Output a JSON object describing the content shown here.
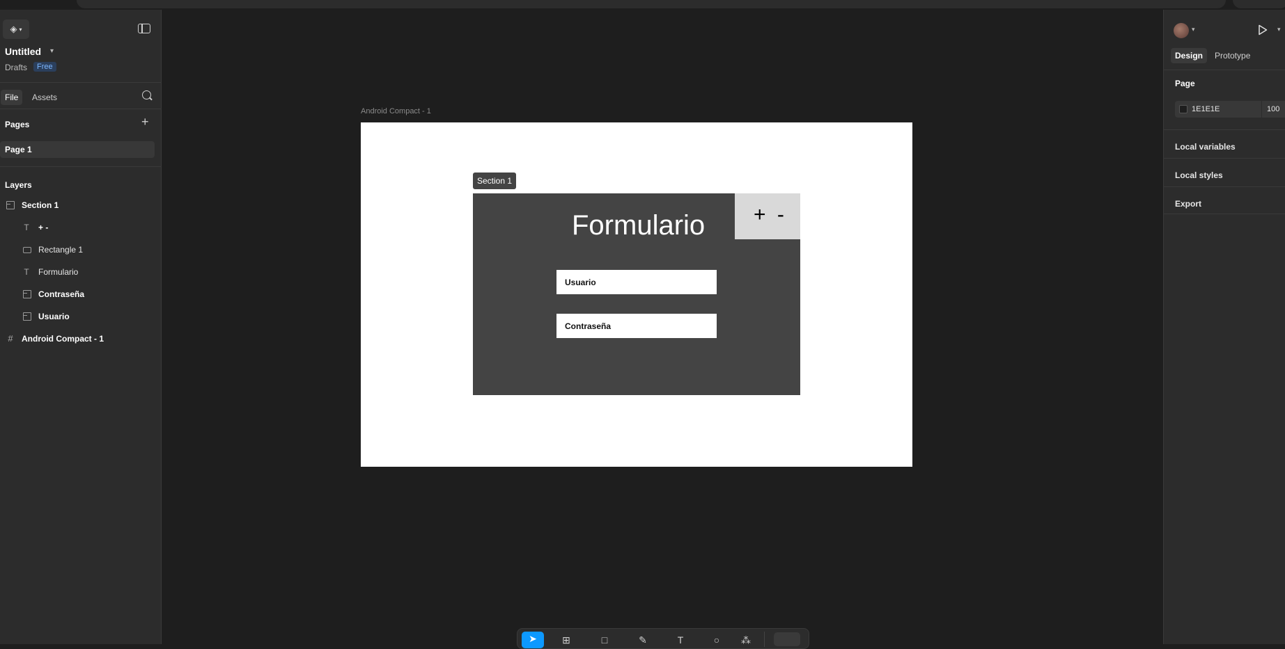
{
  "left": {
    "file_title": "Untitled",
    "drafts_label": "Drafts",
    "plan_badge": "Free",
    "tabs": {
      "file": "File",
      "assets": "Assets"
    },
    "pages_heading": "Pages",
    "pages": [
      "Page 1"
    ],
    "layers_heading": "Layers",
    "layers": [
      {
        "label": "Section 1",
        "icon": "section-icon"
      },
      {
        "label": "+ -",
        "icon": "text-icon"
      },
      {
        "label": "Rectangle 1",
        "icon": "rectangle-icon"
      },
      {
        "label": "Formulario",
        "icon": "text-icon"
      },
      {
        "label": "Contraseña",
        "icon": "section-icon"
      },
      {
        "label": "Usuario",
        "icon": "section-icon"
      },
      {
        "label": "Android Compact - 1",
        "icon": "frame-icon"
      }
    ]
  },
  "canvas": {
    "frame_label": "Android Compact - 1",
    "section_tag": "Section 1",
    "zoom_text": "+ -",
    "form_title": "Formulario",
    "fields": {
      "user": "Usuario",
      "password": "Contraseña"
    }
  },
  "toolbar": {
    "tools": [
      "move-tool-icon",
      "frame-tool-icon",
      "rectangle-tool-icon",
      "pen-tool-icon",
      "text-tool-icon",
      "comment-tool-icon",
      "actions-tool-icon",
      "dev-mode-toggle"
    ]
  },
  "right": {
    "tabs": {
      "design": "Design",
      "prototype": "Prototype"
    },
    "page_heading": "Page",
    "bg_color_hex": "1E1E1E",
    "bg_opacity": "100",
    "sections": [
      "Local variables",
      "Local styles",
      "Export"
    ]
  },
  "colors": {
    "ui_bg": "#2c2c2c",
    "canvas_bg": "#1e1e1e",
    "accent": "#0d99ff",
    "section_fill": "#444444",
    "rect_fill": "#d9d9d9"
  }
}
